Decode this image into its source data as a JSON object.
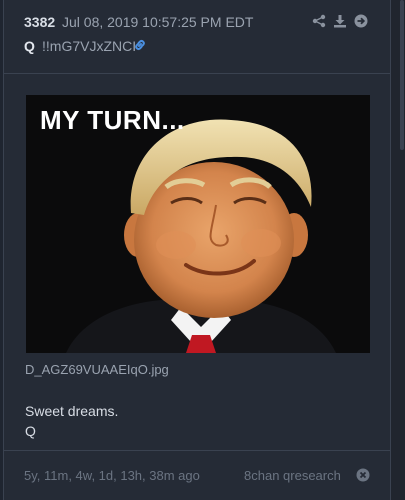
{
  "post": {
    "number": "3382",
    "date": "Jul 08, 2019 10:57:25 PM EDT",
    "author": "Q",
    "tripcode": "!!mG7VJxZNCI",
    "image": {
      "overlay_text": "MY TURN...",
      "filename": "D_AGZ69VUAAEIqO.jpg"
    },
    "body_lines": [
      "Sweet dreams.",
      "Q"
    ],
    "age": "5y, 11m, 4w, 1d, 13h, 38m ago",
    "source": "8chan qresearch"
  },
  "icons": {
    "link": "link-icon",
    "share": "share-icon",
    "download": "download-icon",
    "forward": "forward-arrow-icon",
    "close": "close-circle-icon"
  },
  "colors": {
    "background": "#252b36",
    "accent_link": "#4a8fe0",
    "muted_text": "#9aa3b0",
    "footer_text": "#6b7482"
  }
}
